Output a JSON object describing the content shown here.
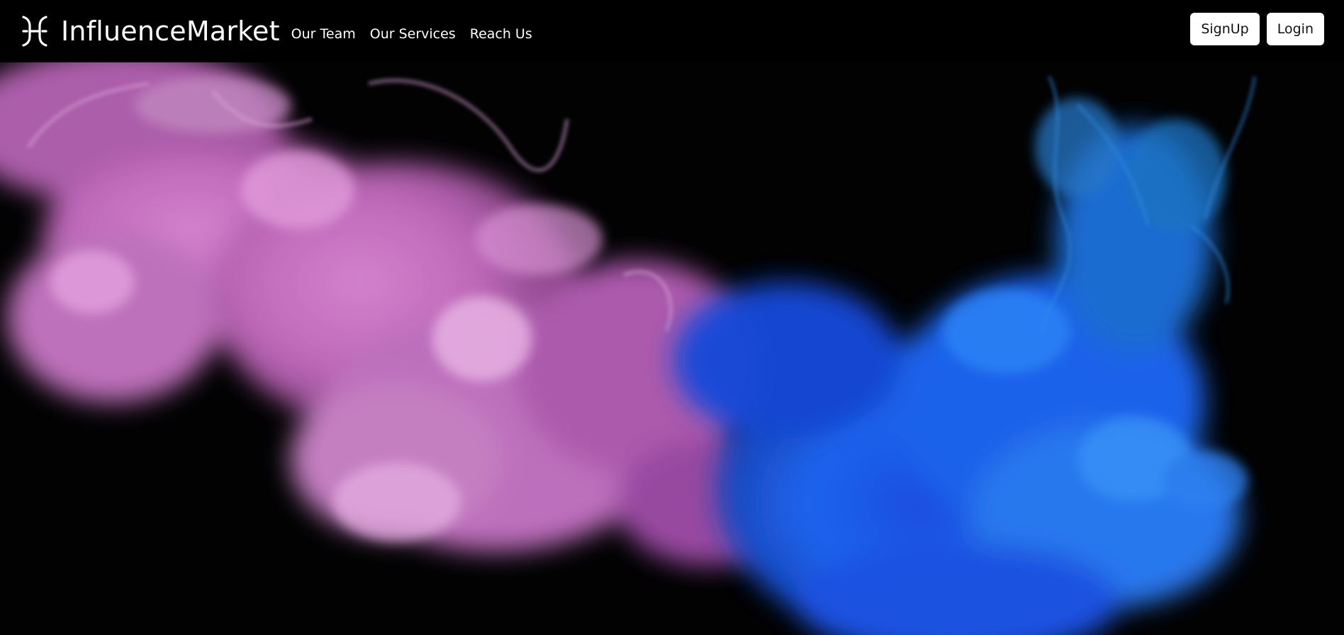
{
  "brand": {
    "name": "InfluenceMarket",
    "logo_icon": "bracket-logo-icon"
  },
  "nav": {
    "items": [
      {
        "label": "Our Team"
      },
      {
        "label": "Our Services"
      },
      {
        "label": "Reach Us"
      }
    ]
  },
  "auth": {
    "signup_label": "SignUp",
    "login_label": "Login"
  },
  "hero": {
    "image": "pink-and-blue-ink-smoke-background",
    "colors": {
      "background": "#020203",
      "pink": "#d57ad0",
      "blue": "#1e5cf0"
    }
  }
}
